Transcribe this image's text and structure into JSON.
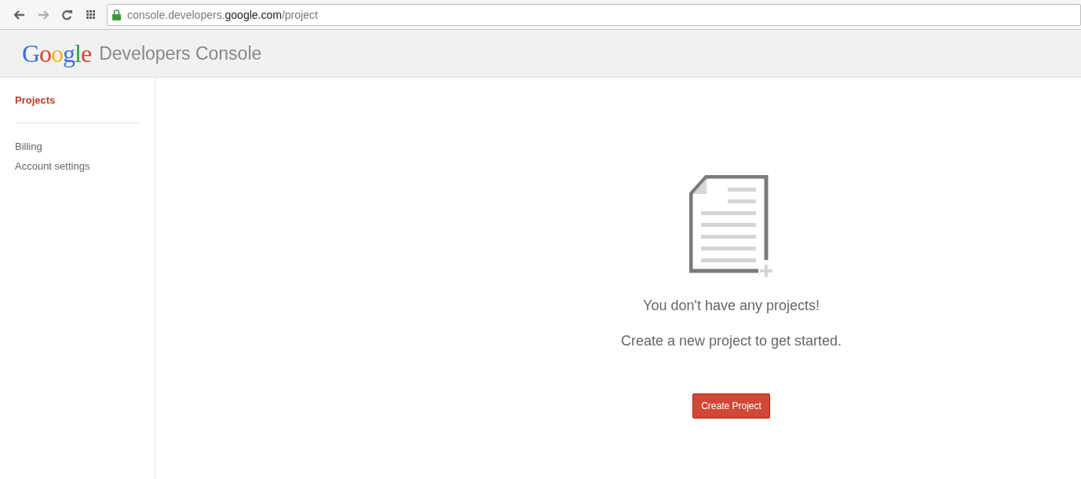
{
  "browser": {
    "url": "console.developers.**google.com**/project"
  },
  "header": {
    "logo": "Google",
    "title": "Developers Console"
  },
  "sidebar": {
    "items": [
      {
        "label": "Projects",
        "selected": true
      },
      {
        "label": "Billing",
        "selected": false
      },
      {
        "label": "Account settings",
        "selected": false
      }
    ]
  },
  "empty_state": {
    "heading": "You don't have any projects!",
    "subheading": "Create a new project to get started.",
    "button": "Create Project"
  }
}
